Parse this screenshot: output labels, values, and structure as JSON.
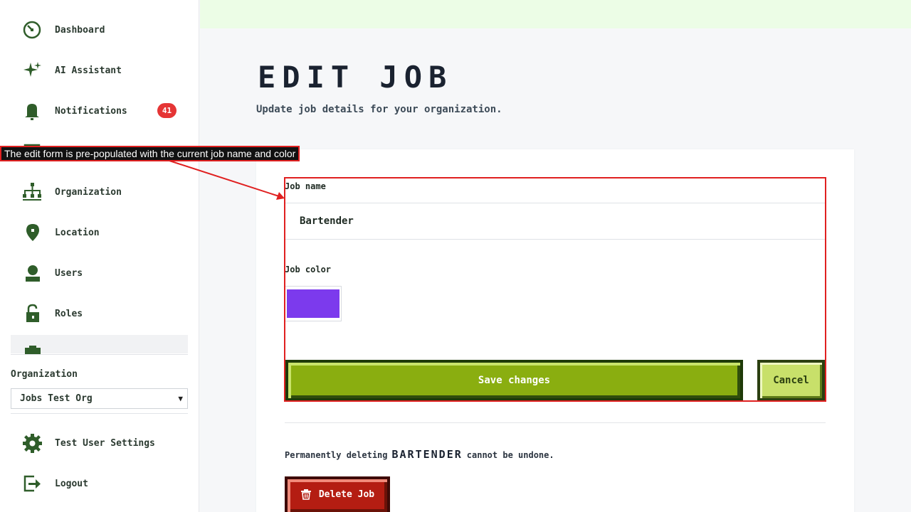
{
  "sidebar": {
    "items": [
      {
        "label": "Dashboard",
        "icon": "dashboard-icon"
      },
      {
        "label": "AI Assistant",
        "icon": "sparkle-icon"
      },
      {
        "label": "Notifications",
        "icon": "bell-icon",
        "badge": "41"
      },
      {
        "label": "",
        "icon": "calendar-icon"
      },
      {
        "label": "Organization",
        "icon": "org-chart-icon"
      },
      {
        "label": "Location",
        "icon": "map-pin-icon"
      },
      {
        "label": "Users",
        "icon": "user-icon"
      },
      {
        "label": "Roles",
        "icon": "lock-icon"
      },
      {
        "label": "",
        "icon": "briefcase-icon"
      }
    ],
    "org_label": "Organization",
    "org_select_value": "Jobs Test Org",
    "settings_label": "Test User Settings",
    "logout_label": "Logout"
  },
  "page": {
    "title": "EDIT JOB",
    "subtitle": "Update job details for your organization."
  },
  "form": {
    "job_name_label": "Job name",
    "job_name_value": "Bartender",
    "job_color_label": "Job color",
    "job_color_value": "#7c3aed",
    "save_label": "Save changes",
    "cancel_label": "Cancel"
  },
  "danger": {
    "text_before": "Permanently deleting",
    "job_name": "BARTENDER",
    "text_after": "cannot be undone.",
    "delete_label": "Delete Job"
  },
  "annotation": {
    "text": "The edit form is pre-populated with the current job name and color"
  },
  "colors": {
    "icon_green": "#2f5d2a",
    "save_green": "#8aae10",
    "cancel_lime": "#c8e06a",
    "danger_red": "#b41d12",
    "badge_red": "#e53535",
    "topbar": "#ecfde6",
    "annotation_red": "#e02020"
  }
}
